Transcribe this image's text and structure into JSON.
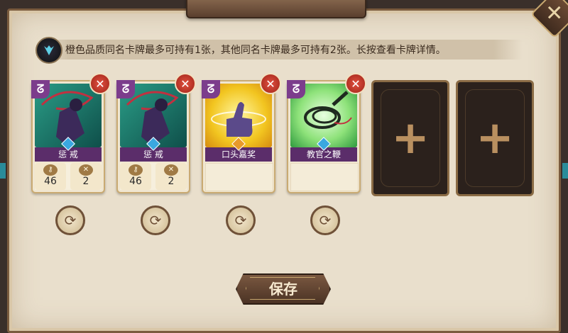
{
  "title": "",
  "close_label": "✕",
  "notice": "橙色品质同名卡牌最多可持有1张，其他同名卡牌最多可持有2张。长按查看卡牌详情。",
  "cards": [
    {
      "name": "惩 戒",
      "type_glyph": "Ђ",
      "remove": "✕",
      "gem_color": "#3aa8e0",
      "stat_a": "46",
      "stat_b": "2",
      "art_bg": "linear-gradient(135deg,#2a9c86,#0f4f4a)",
      "art_icon": "whip-figure-icon"
    },
    {
      "name": "惩 戒",
      "type_glyph": "Ђ",
      "remove": "✕",
      "gem_color": "#3aa8e0",
      "stat_a": "46",
      "stat_b": "2",
      "art_bg": "linear-gradient(135deg,#2a9c86,#0f4f4a)",
      "art_icon": "whip-figure-icon"
    },
    {
      "name": "口头嘉奖",
      "type_glyph": "Ђ",
      "remove": "✕",
      "gem_color": "#e89a2a",
      "stat_a": "",
      "stat_b": "",
      "art_bg": "radial-gradient(circle,#fff7a0,#f2c520 60%,#d58a10)",
      "art_icon": "thumbs-up-icon"
    },
    {
      "name": "教官之鞭",
      "type_glyph": "Ђ",
      "remove": "✕",
      "gem_color": "#3aa8e0",
      "stat_a": "",
      "stat_b": "",
      "art_bg": "radial-gradient(circle,#e8ffe0,#8ee27a 55%,#2f9a3e)",
      "art_icon": "coiled-whip-icon"
    }
  ],
  "empty_slots": [
    "+",
    "+"
  ],
  "swap_glyph": "⟳",
  "save_label": "保存"
}
